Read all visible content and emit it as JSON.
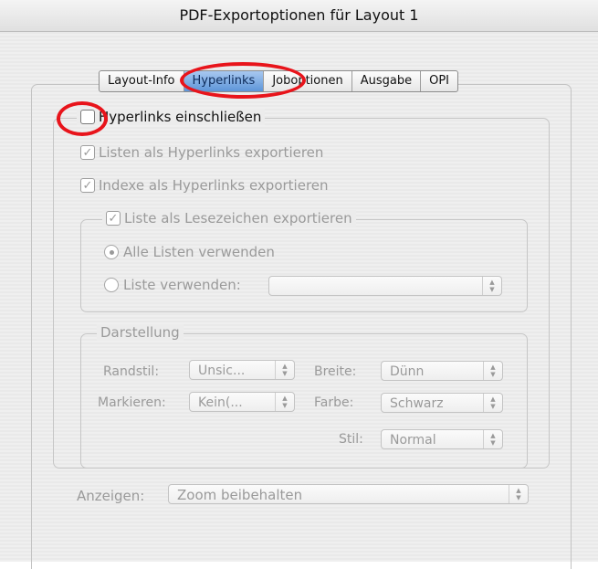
{
  "window": {
    "title": "PDF-Exportoptionen für Layout 1"
  },
  "tabs": [
    {
      "label": "Layout-Info"
    },
    {
      "label": "Hyperlinks"
    },
    {
      "label": "Joboptionen"
    },
    {
      "label": "Ausgabe"
    },
    {
      "label": "OPI"
    }
  ],
  "active_tab": "Hyperlinks",
  "hyperlinks": {
    "include_label": "Hyperlinks einschließen",
    "include_checked": false,
    "lists_label": "Listen als Hyperlinks exportieren",
    "lists_checked": true,
    "indexes_label": "Indexe als Hyperlinks exportieren",
    "indexes_checked": true,
    "bookmarks": {
      "label": "Liste als Lesezeichen exportieren",
      "checked": true,
      "all_lists_label": "Alle Listen verwenden",
      "use_list_label": "Liste verwenden:",
      "use_list_value": ""
    },
    "appearance": {
      "legend": "Darstellung",
      "border_style_label": "Randstil:",
      "border_style_value": "Unsic...",
      "width_label": "Breite:",
      "width_value": "Dünn",
      "highlight_label": "Markieren:",
      "highlight_value": "Kein(...",
      "color_label": "Farbe:",
      "color_value": "Schwarz",
      "style_label": "Stil:",
      "style_value": "Normal"
    },
    "display_label": "Anzeigen:",
    "display_value": "Zoom beibehalten"
  },
  "annotation_color": "#e8141b"
}
